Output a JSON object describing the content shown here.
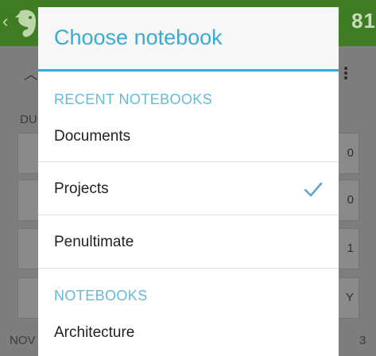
{
  "background": {
    "note_count": "81",
    "section_label": "DU",
    "footer_label": "NOV",
    "page_number": "3",
    "row_edges": [
      "0",
      "0",
      "1",
      "Y"
    ]
  },
  "dialog": {
    "title": "Choose notebook",
    "sections": [
      {
        "header": "RECENT NOTEBOOKS",
        "items": [
          {
            "label": "Documents",
            "selected": false
          },
          {
            "label": "Projects",
            "selected": true
          },
          {
            "label": "Penultimate",
            "selected": false
          }
        ]
      },
      {
        "header": "NOTEBOOKS",
        "items": [
          {
            "label": "Architecture",
            "selected": false
          }
        ]
      }
    ]
  },
  "colors": {
    "accent": "#3aabd2",
    "toolbar_green": "#3f7d25",
    "check": "#5fa7cc"
  }
}
